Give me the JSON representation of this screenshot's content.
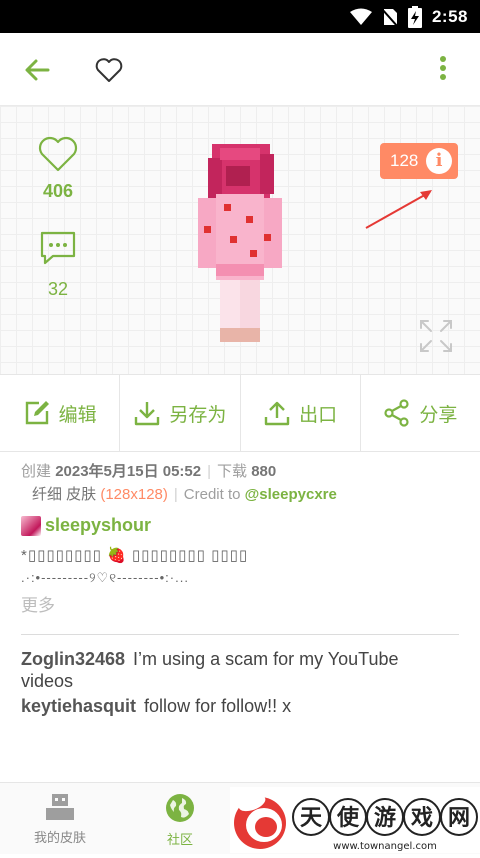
{
  "status_bar": {
    "time": "2:58"
  },
  "preview": {
    "likes_count": "406",
    "comments_count": "32",
    "resolution_badge": "128",
    "info_glyph": "i"
  },
  "actions": [
    {
      "label": "编辑",
      "icon": "edit-icon"
    },
    {
      "label": "另存为",
      "icon": "download-icon"
    },
    {
      "label": "出口",
      "icon": "upload-icon"
    },
    {
      "label": "分享",
      "icon": "share-icon"
    }
  ],
  "meta": {
    "created_label": "创建",
    "created_value": "2023年5月15日 05:52",
    "downloads_label": "下载",
    "downloads_value": "880",
    "type": "纤细 皮肤",
    "resolution": "(128x128)",
    "credit_label": "Credit to",
    "credit_handle": "@sleepycxre"
  },
  "author": {
    "name": "sleepyshour"
  },
  "description": {
    "line1": "*▯▯▯▯▯▯▯▯ 🍓 ▯▯▯▯▯▯▯▯ ▯▯▯▯",
    "line2": ".·:•---------୨♡୧--------•:·..."
  },
  "more_label": "更多",
  "comments": [
    {
      "user": "Zoglin32468",
      "text": "I’m using a scam for my YouTube videos"
    },
    {
      "user": "keytiehasquit",
      "text": "follow for follow!! x"
    }
  ],
  "bottom_nav": [
    {
      "label": "我的皮肤",
      "icon": "my-skins-icon",
      "active": false
    },
    {
      "label": "社区",
      "icon": "globe-icon",
      "active": true
    }
  ],
  "watermark": {
    "chars": [
      "天",
      "使",
      "游",
      "戏",
      "网"
    ],
    "url": "www.townangel.com"
  },
  "colors": {
    "accent": "#7cb342",
    "badge": "#ff8a65",
    "annotation": "#e53935"
  }
}
